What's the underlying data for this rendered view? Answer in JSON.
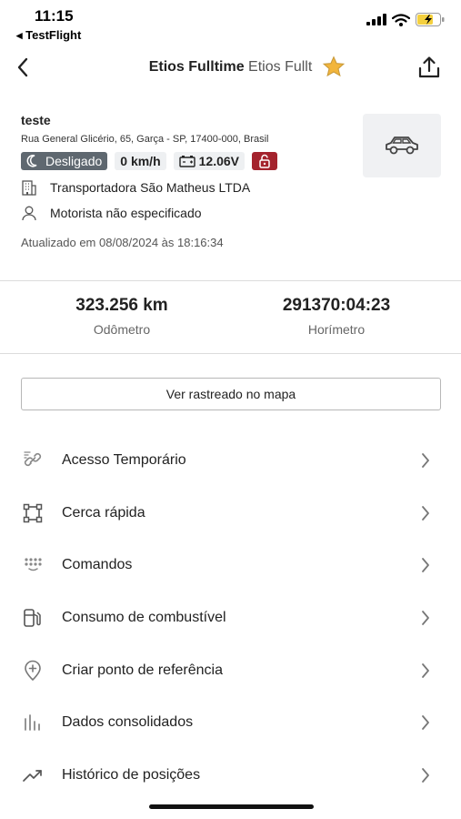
{
  "status_bar": {
    "time": "11:15",
    "back_app": "TestFlight"
  },
  "nav": {
    "title_main": "Etios Fulltime",
    "title_sub": "Etios Fullt"
  },
  "vehicle": {
    "name": "teste",
    "address": "Rua General Glicério, 65, Garça - SP, 17400-000, Brasil",
    "status": "Desligado",
    "speed": "0 km/h",
    "voltage": "12.06V",
    "company": "Transportadora São Matheus LTDA",
    "driver": "Motorista não especificado",
    "updated": "Atualizado em 08/08/2024 às 18:16:34"
  },
  "stats": {
    "odometer_value": "323.256 km",
    "odometer_label": "Odômetro",
    "hourmeter_value": "291370:04:23",
    "hourmeter_label": "Horímetro"
  },
  "map_button_label": "Ver rastreado no mapa",
  "menu": [
    {
      "label": "Acesso Temporário",
      "icon": "link-icon"
    },
    {
      "label": "Cerca rápida",
      "icon": "fence-icon"
    },
    {
      "label": "Comandos",
      "icon": "keypad-icon"
    },
    {
      "label": "Consumo de combustível",
      "icon": "fuel-icon"
    },
    {
      "label": "Criar ponto de referência",
      "icon": "pin-plus-icon"
    },
    {
      "label": "Dados consolidados",
      "icon": "bar-chart-icon"
    },
    {
      "label": "Histórico de posições",
      "icon": "trend-icon"
    }
  ],
  "colors": {
    "status_chip": "#5f6870",
    "lock_chip": "#a4232d",
    "star": "#f2b53c"
  }
}
